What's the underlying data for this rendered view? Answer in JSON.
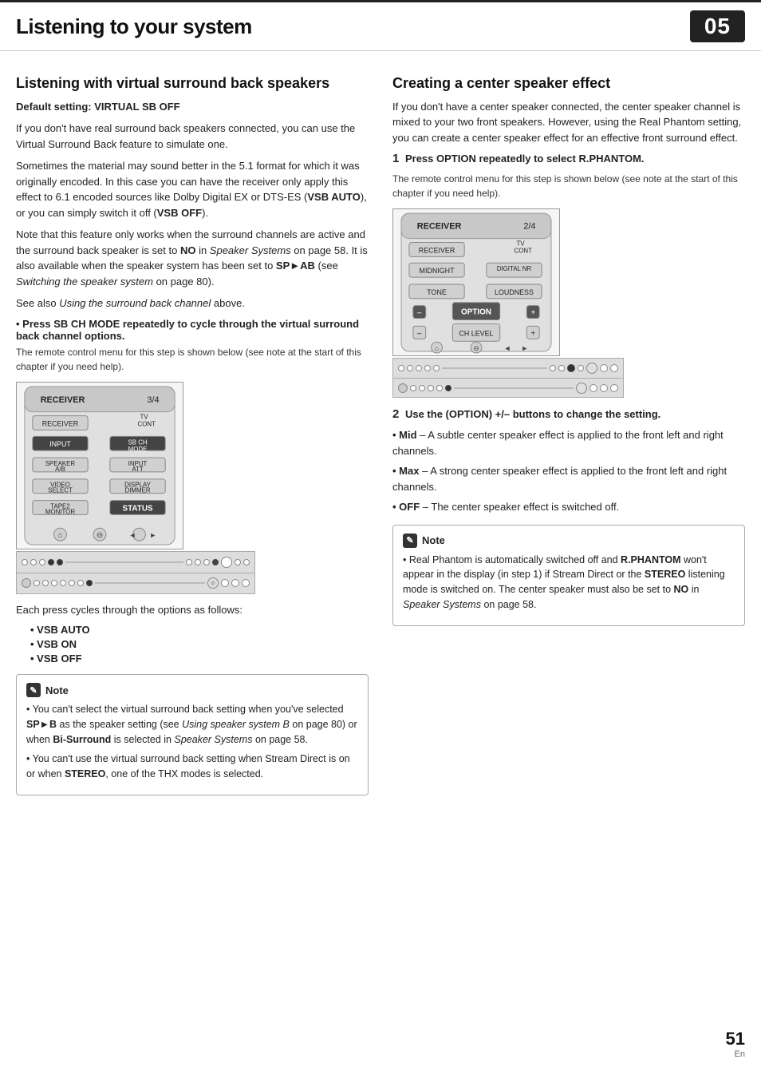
{
  "header": {
    "title": "Listening to your system",
    "chapter": "05"
  },
  "left_section": {
    "title": "Listening with virtual surround back speakers",
    "default_setting_label": "Default setting:",
    "default_setting_value": "VIRTUAL SB OFF",
    "para1": "If you don't have real surround back speakers connected, you can use the Virtual Surround Back feature to simulate one.",
    "para2": "Sometimes the material may sound better in the 5.1 format for which it was originally encoded. In this case you can have the receiver only apply this effect to 6.1 encoded sources like Dolby Digital EX or DTS-ES (",
    "para2_bold1": "VSB AUTO",
    "para2_mid": "), or you can simply switch it off (",
    "para2_bold2": "VSB OFF",
    "para2_end": ").",
    "para3_pre": "Note that this feature only works when the surround channels are active and the surround back speaker is set to ",
    "para3_bold1": "NO",
    "para3_mid1": " in ",
    "para3_italic1": "Speaker Systems",
    "para3_mid2": " on page 58. It is also available when the speaker system has been set to ",
    "para3_bold2": "SP►AB",
    "para3_mid3": " (see ",
    "para3_italic2": "Switching the speaker system",
    "para3_end": " on page 80).",
    "para4_pre": "See also ",
    "para4_italic": "Using the surround back channel",
    "para4_end": " above.",
    "bullet2_title": "Press SB CH MODE repeatedly to cycle through the virtual surround back channel options.",
    "remote_label": "The remote control menu for this step is shown below (see note at the start of this chapter if you need help).",
    "remote": {
      "label": "RECEIVER",
      "page": "3/4",
      "tv_cont": "TV CONT",
      "receiver_btn": "RECEIVER",
      "input_btn": "INPUT",
      "sb_ch_mode_btn": "SB CH MODE",
      "speaker_ab": "SPEAKER A/B",
      "input_att": "INPUT ATT",
      "video_select": "VIDEO SELECT",
      "display_dimmer": "DISPLAY DIMMER",
      "tape2_monitor": "TAPE2 MONITOR",
      "status_btn": "STATUS"
    },
    "cycle_label": "Each press cycles through the options as follows:",
    "options": [
      "VSB AUTO",
      "VSB ON",
      "VSB OFF"
    ],
    "note_title": "Note",
    "note_items": [
      "You can't select the virtual surround back setting when you've selected SP►B as the speaker setting (see Using speaker system B on page 80) or when Bi-Surround is selected in Speaker Systems on page 58.",
      "You can't use the virtual surround back setting when Stream Direct is on or when STEREO, one of the THX modes is selected."
    ]
  },
  "right_section": {
    "title": "Creating a center speaker effect",
    "para1": "If you don't have a center speaker connected, the center speaker channel is mixed to your two front speakers. However, using the Real Phantom setting, you can create a center speaker effect for an effective front surround effect.",
    "step1_number": "1",
    "step1_text": "Press OPTION repeatedly to select R.PHANTOM.",
    "step1_sub": "The remote control menu for this step is shown below (see note at the start of this chapter if you need help).",
    "remote2": {
      "label": "RECEIVER",
      "page": "2/4",
      "tv_cont": "TV CONT",
      "receiver_btn": "RECEIVER",
      "midnight": "MIDNIGHT",
      "digital_nr": "DIGITAL NR",
      "tone": "TONE",
      "loudness": "LOUDNESS",
      "option_minus": "–",
      "option_label": "OPTION",
      "option_plus": "+",
      "chlevel_minus": "–",
      "chlevel_label": "CH LEVEL",
      "chlevel_plus": "+"
    },
    "step2_number": "2",
    "step2_text": "Use the (OPTION) +/– buttons to change the setting.",
    "step2_items": [
      {
        "label": "Mid",
        "desc": "– A subtle center speaker effect is applied to the front left and right channels."
      },
      {
        "label": "Max",
        "desc": "– A strong center speaker effect is applied to the front left and right channels."
      },
      {
        "label": "OFF",
        "desc": "– The center speaker effect is switched off."
      }
    ],
    "note_title": "Note",
    "note_items": [
      "Real Phantom is automatically switched off and R.PHANTOM won't appear in the display (in step 1) if Stream Direct or the STEREO listening mode is switched on. The center speaker must also be set to NO in Speaker Systems on page 58."
    ]
  },
  "footer": {
    "page_number": "51",
    "lang": "En"
  }
}
